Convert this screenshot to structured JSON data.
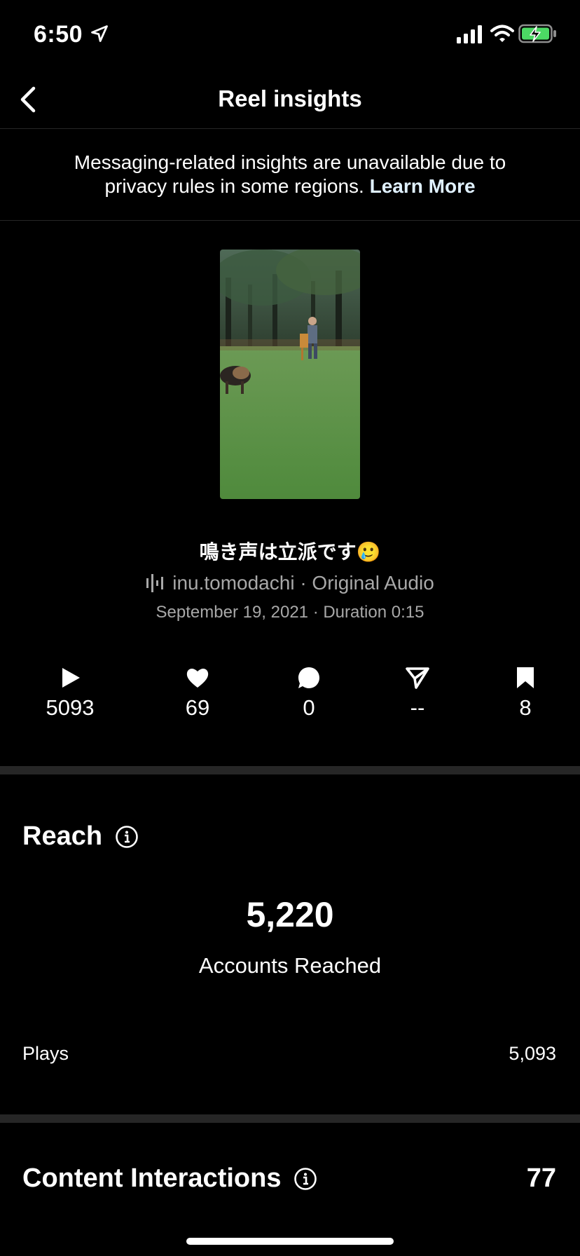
{
  "status_bar": {
    "time": "6:50"
  },
  "nav": {
    "title": "Reel insights"
  },
  "notice": {
    "text": "Messaging-related insights are unavailable due to privacy rules in some regions.",
    "link": "Learn More"
  },
  "reel": {
    "caption": "鳴き声は立派です🥲",
    "audio": "inu.tomodachi · Original Audio",
    "meta": "September 19, 2021 · Duration 0:15"
  },
  "stats": {
    "plays": "5093",
    "likes": "69",
    "comments": "0",
    "shares": "--",
    "saves": "8"
  },
  "reach": {
    "title": "Reach",
    "accounts_reached": "5,220",
    "accounts_reached_label": "Accounts Reached",
    "plays_label": "Plays",
    "plays_value": "5,093"
  },
  "content_interactions": {
    "title": "Content Interactions",
    "value": "77"
  },
  "colors": {
    "background": "#000000",
    "divider": "#262626",
    "secondary_text": "#a8a8a8",
    "battery_green": "#4cd964"
  }
}
